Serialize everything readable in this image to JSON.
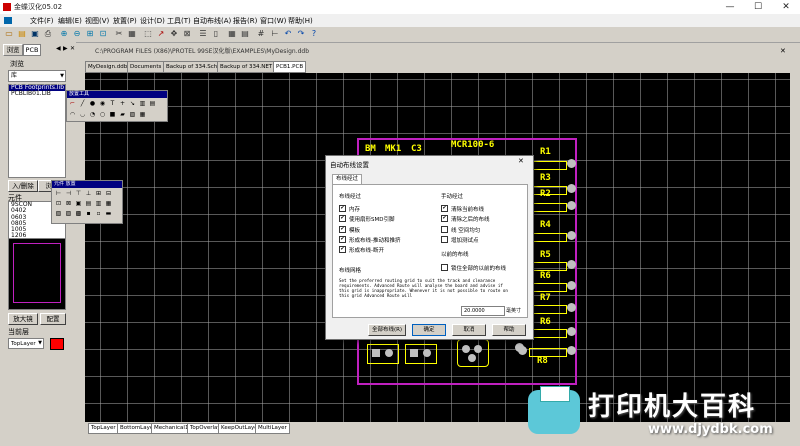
{
  "window": {
    "title": "金蝶汉化05.02"
  },
  "menu": [
    "文件(F)",
    "编辑(E)",
    "视图(V)",
    "放置(P)",
    "设计(D)",
    "工具(T)",
    "自动布线(A)",
    "报告(R)",
    "窗口(W)",
    "帮助(H)"
  ],
  "path_bar": "C:\\PROGRAM FILES (X86)\\PROTEL 99SE汉化版\\EXAMPLES\\MyDesign.ddb",
  "left_panel": {
    "tabs": [
      "浏览",
      "PCB"
    ],
    "browse_label": "浏览",
    "browse_select": "库",
    "libraries": [
      "PCB Footprints.lib",
      "PCBLIB01.LIB"
    ],
    "add_remove": "入/删除",
    "browse_btn": "浏览",
    "components_label": "元件",
    "components": [
      "9SCON",
      "0402",
      "0603",
      "0805",
      "1005",
      "1206",
      "1210",
      "1805"
    ],
    "edit_btn": "编辑",
    "place_btn": "放",
    "zoom_btn": "放大镜",
    "config_btn": "配置",
    "layer_label": "当前层",
    "layer_select": "TopLayer"
  },
  "doc_tabs": [
    "MyDesign.ddb",
    "Documents",
    "Backup of 334.Sch",
    "Backup of 334.NET",
    "PCB1.PCB"
  ],
  "layer_tabs": [
    "TopLayer",
    "BottomLayer",
    "Mechanical1",
    "TopOverlay",
    "KeepOutLayer",
    "MultiLayer"
  ],
  "palettes": {
    "placement": {
      "title": "放置工具"
    },
    "component": {
      "title": "元件 放置"
    }
  },
  "pcb": {
    "top_labels": [
      "BM",
      "MK1",
      "C3",
      "MCR100-6"
    ],
    "resistors": [
      "R1",
      "R3",
      "R2",
      "R4",
      "R5",
      "R6",
      "R7",
      "R6",
      "R8"
    ]
  },
  "dialog": {
    "title": "自动布线设置",
    "tab": "布线经过",
    "section_left": "布线经过",
    "left_options": [
      {
        "label": "内存",
        "checked": true
      },
      {
        "label": "使用扇形SMD引脚",
        "checked": true
      },
      {
        "label": "模板",
        "checked": true
      },
      {
        "label": "形成布线-推动和推挤",
        "checked": true
      },
      {
        "label": "形成布线-断开",
        "checked": true
      }
    ],
    "section_right": "手动经过",
    "right_options": [
      {
        "label": "清除当前布线",
        "checked": true
      },
      {
        "label": "清除之后的布线",
        "checked": true
      },
      {
        "label": "线 空间均匀",
        "checked": false
      },
      {
        "label": "增加测试点",
        "checked": false
      }
    ],
    "section_previous": "以前的布线",
    "lock_option": {
      "label": "锁住全部的以前的布线",
      "checked": false
    },
    "grid_section": "布线网格",
    "grid_text": "Set the preferred routing grid to suit the track and clearance requirements. Advanced Route will analyse the board and advise if this grid is inappropriate. Whenever it is not possible to route on this grid Advanced Route will",
    "grid_value": "20.0000",
    "grid_unit": "毫英寸",
    "buttons": {
      "route_all": "全部布线(R)",
      "ok": "确定",
      "cancel": "取消",
      "help": "帮助"
    }
  },
  "watermark": {
    "text": "打印机大百科",
    "url": "www.djydbk.com"
  }
}
